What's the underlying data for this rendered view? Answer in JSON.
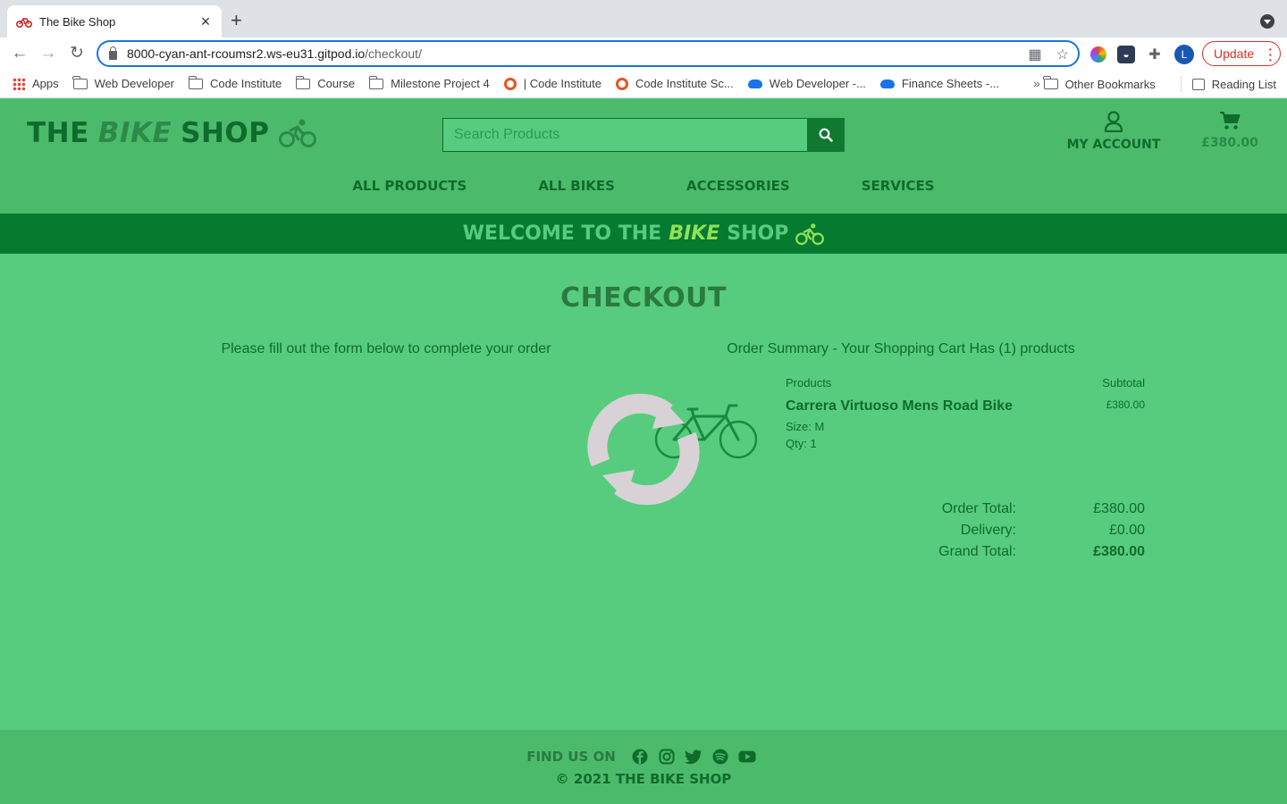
{
  "browser": {
    "tab_title": "The Bike Shop",
    "url_host": "8000-cyan-ant-rcoumsr2.ws-eu31.gitpod.io",
    "url_path": "/checkout/",
    "update_label": "Update",
    "avatar_letter": "L",
    "bookmarks": [
      {
        "label": "Apps",
        "icon": "apps-icon"
      },
      {
        "label": "Web Developer",
        "icon": "folder-icon"
      },
      {
        "label": "Code Institute",
        "icon": "folder-icon"
      },
      {
        "label": "Course",
        "icon": "folder-icon"
      },
      {
        "label": "Milestone Project 4",
        "icon": "folder-icon"
      },
      {
        "label": "| Code Institute",
        "icon": "ring-icon"
      },
      {
        "label": "Code Institute Sc...",
        "icon": "ring-icon"
      },
      {
        "label": "Web Developer -...",
        "icon": "cloud-icon"
      },
      {
        "label": "Finance Sheets -...",
        "icon": "cloud-icon"
      }
    ],
    "other_bookmarks": "Other Bookmarks",
    "reading_list": "Reading List"
  },
  "header": {
    "logo_the": "THE",
    "logo_bike": "BIKE",
    "logo_shop": "SHOP",
    "search_placeholder": "Search Products",
    "account_label": "MY ACCOUNT",
    "cart_total": "£380.00",
    "nav": [
      "ALL PRODUCTS",
      "ALL BIKES",
      "ACCESSORIES",
      "SERVICES"
    ]
  },
  "banner": {
    "pre": "WELCOME TO THE",
    "bike": "BIKE",
    "post": "SHOP"
  },
  "checkout": {
    "title": "CHECKOUT",
    "form_intro": "Please fill out the form below to complete your order",
    "summary_intro": "Order Summary - Your Shopping Cart Has (1) products",
    "col_products": "Products",
    "col_subtotal": "Subtotal",
    "item": {
      "name": "Carrera Virtuoso Mens Road Bike",
      "size": "Size: M",
      "qty": "Qty: 1",
      "price": "£380.00"
    },
    "totals": [
      {
        "label": "Order Total:",
        "value": "£380.00"
      },
      {
        "label": "Delivery:",
        "value": "£0.00"
      },
      {
        "label": "Grand Total:",
        "value": "£380.00"
      }
    ]
  },
  "footer": {
    "find_us": "FIND US ON",
    "social": [
      "facebook-icon",
      "instagram-icon",
      "twitter-icon",
      "spotify-icon",
      "youtube-icon"
    ],
    "copyright": "© 2021 THE BIKE SHOP"
  },
  "colors": {
    "page_bg": "#57cc7e",
    "header_bg": "#4bbb6b",
    "banner_bg": "#067a2e",
    "text_dark_green": "#0f6b2c"
  }
}
